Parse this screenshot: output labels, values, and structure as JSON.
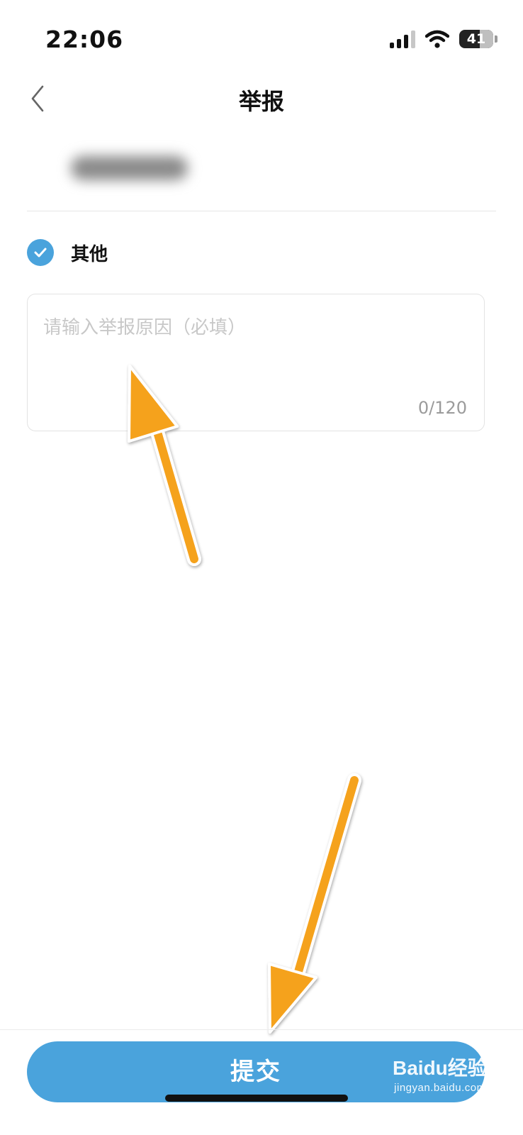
{
  "status_bar": {
    "time": "22:06",
    "battery": "41",
    "icons": [
      "cellular-signal-icon",
      "wifi-icon",
      "battery-icon"
    ]
  },
  "nav": {
    "title": "举报",
    "back_icon": "chevron-left-icon"
  },
  "reason": {
    "option_label": "其他",
    "selected": true,
    "input_placeholder": "请输入举报原因（必填）",
    "input_value": "",
    "char_count": "0/120"
  },
  "submit": {
    "label": "提交"
  },
  "watermark": {
    "brand": "Baidu经验",
    "url": "jingyan.baidu.com"
  },
  "colors": {
    "accent": "#4aa3dc",
    "annotation_arrow": "#f5a21f"
  }
}
